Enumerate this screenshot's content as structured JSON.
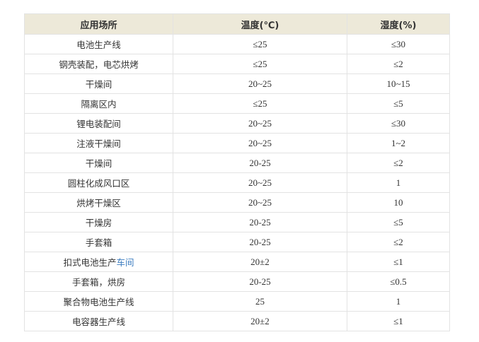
{
  "table": {
    "headers": [
      "应用场所",
      "温度(℃)",
      "湿度(%)"
    ],
    "rows": [
      {
        "place": "电池生产线",
        "place_link": "",
        "temp": "≤25",
        "humidity": "≤30"
      },
      {
        "place": "钢壳装配，电芯烘烤",
        "place_link": "",
        "temp": "≤25",
        "humidity": "≤2"
      },
      {
        "place": "干燥间",
        "place_link": "",
        "temp": "20~25",
        "humidity": "10~15"
      },
      {
        "place": "隔离区内",
        "place_link": "",
        "temp": "≤25",
        "humidity": "≤5"
      },
      {
        "place": "锂电装配间",
        "place_link": "",
        "temp": "20~25",
        "humidity": "≤30"
      },
      {
        "place": "注液干燥间",
        "place_link": "",
        "temp": "20~25",
        "humidity": "1~2"
      },
      {
        "place": "干燥间",
        "place_link": "",
        "temp": "20-25",
        "humidity": "≤2"
      },
      {
        "place": "圆柱化成风口区",
        "place_link": "",
        "temp": "20~25",
        "humidity": "1"
      },
      {
        "place": "烘烤干燥区",
        "place_link": "",
        "temp": "20~25",
        "humidity": "10"
      },
      {
        "place": "干燥房",
        "place_link": "",
        "temp": "20-25",
        "humidity": "≤5"
      },
      {
        "place": "手套箱",
        "place_link": "",
        "temp": "20-25",
        "humidity": "≤2"
      },
      {
        "place": "扣式电池生产",
        "place_link": "车间",
        "temp": "20±2",
        "humidity": "≤1"
      },
      {
        "place": "手套箱，烘房",
        "place_link": "",
        "temp": "20-25",
        "humidity": "≤0.5"
      },
      {
        "place": "聚合物电池生产线",
        "place_link": "",
        "temp": "25",
        "humidity": "1"
      },
      {
        "place": "电容器生产线",
        "place_link": "",
        "temp": "20±2",
        "humidity": "≤1"
      }
    ]
  },
  "colors": {
    "header_bg": "#ede9d9",
    "border": "#e3e3e3",
    "link": "#3a7bbf",
    "text": "#333333"
  }
}
